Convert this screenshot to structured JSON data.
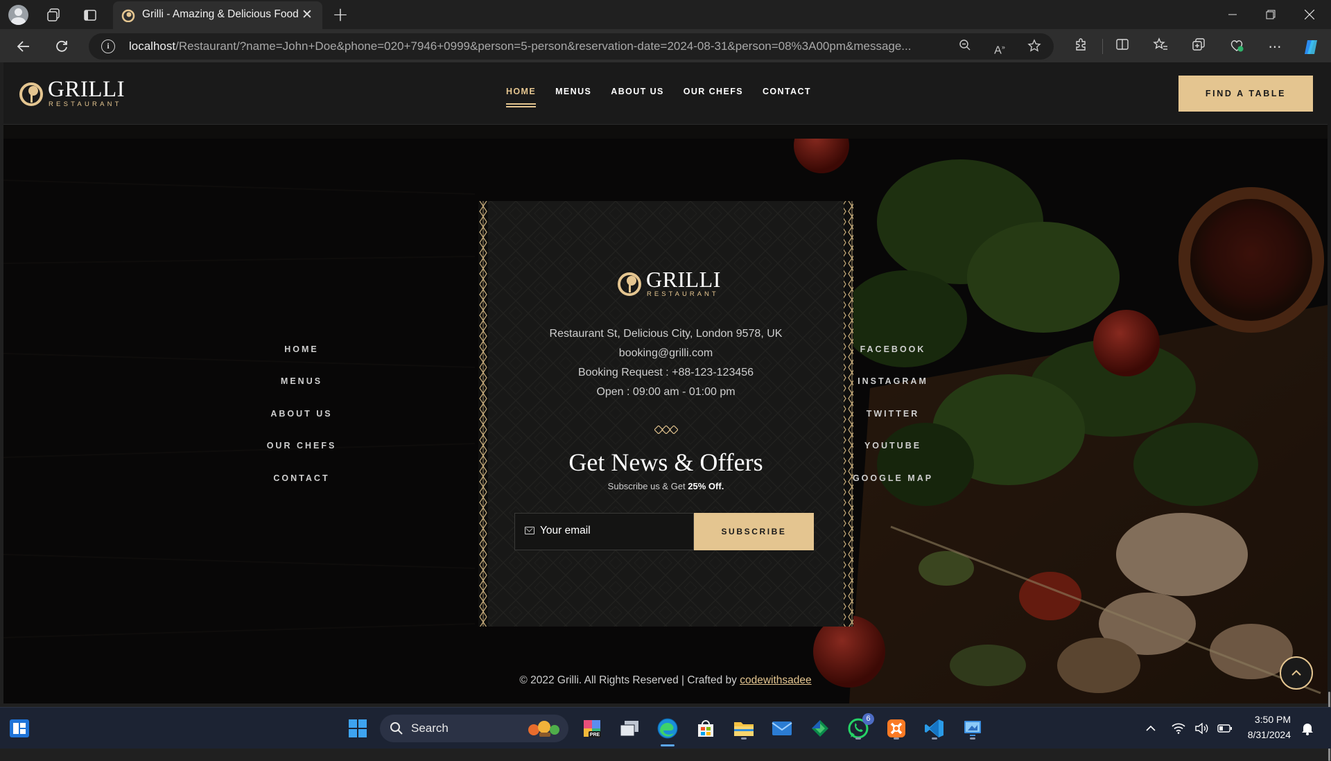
{
  "browser": {
    "tab_title": "Grilli - Amazing & Delicious Food",
    "url_host": "localhost",
    "url_rest": "/Restaurant/?name=John+Doe&phone=020+7946+0999&person=5-person&reservation-date=2024-08-31&person=08%3A00pm&message..."
  },
  "header": {
    "logo_name": "GRILLI",
    "logo_sub": "RESTAURANT",
    "nav": [
      {
        "label": "HOME",
        "active": true
      },
      {
        "label": "MENUS"
      },
      {
        "label": "ABOUT US"
      },
      {
        "label": "OUR CHEFS"
      },
      {
        "label": "CONTACT"
      }
    ],
    "cta": "FIND A TABLE"
  },
  "footer": {
    "logo_name": "GRILLI",
    "logo_sub": "RESTAURANT",
    "address": "Restaurant St, Delicious City, London 9578, UK",
    "email": "booking@grilli.com",
    "booking": "Booking Request : +88-123-123456",
    "hours": "Open : 09:00 am - 01:00 pm",
    "news_title": "Get News & Offers",
    "news_sub_prefix": "Subscribe us & Get ",
    "news_sub_highlight": "25% Off.",
    "email_placeholder": "Your email",
    "subscribe": "SUBSCRIBE",
    "left_links": [
      "HOME",
      "MENUS",
      "ABOUT US",
      "OUR CHEFS",
      "CONTACT"
    ],
    "right_links": [
      "FACEBOOK",
      "INSTAGRAM",
      "TWITTER",
      "YOUTUBE",
      "GOOGLE MAP"
    ],
    "copyright_prefix": "© 2022 Grilli. All Rights Reserved | Crafted by ",
    "copyright_credit": "codewithsadee"
  },
  "taskbar": {
    "search_label": "Search",
    "whatsapp_badge": "6",
    "time": "3:50 PM",
    "date": "8/31/2024"
  },
  "colors": {
    "accent": "#e4c590",
    "page_bg": "#0e0d0c",
    "header_bg": "#1a1a1a",
    "taskbar_bg": "#1c2333"
  }
}
